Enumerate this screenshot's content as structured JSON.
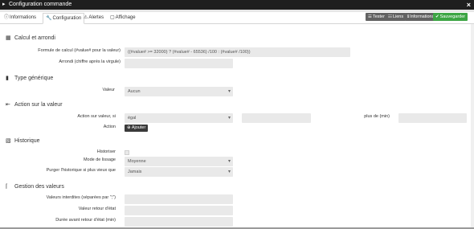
{
  "window": {
    "title": "Configuration commande",
    "close_label": "×"
  },
  "tabs": [
    {
      "label": "Informations",
      "icon": "info-icon"
    },
    {
      "label": "Configuration",
      "icon": "wrench-icon"
    },
    {
      "label": "Alertes",
      "icon": "warning-icon"
    },
    {
      "label": "Affichage",
      "icon": "display-icon"
    }
  ],
  "toolbar": {
    "tester": "Tester",
    "liens": "Liens",
    "informations": "Informations",
    "sauvegarder": "Sauvegarder"
  },
  "calcul": {
    "title": "Calcul et arrondi",
    "formula_label": "Formule de calcul (#value# pour la valeur)",
    "formula_value": "((#value# >= 32000) ? (#value# - 65536) /100 : (#value# /100))",
    "round_label": "Arrondi (chiffre après la virgule)",
    "round_value": ""
  },
  "type": {
    "title": "Type générique",
    "valeur_label": "Valeur",
    "valeur_value": "Aucun"
  },
  "action": {
    "title": "Action sur la valeur",
    "condition_label": "Action sur valeur, si",
    "condition_value": "égal",
    "compare_value": "",
    "duration_label": "plus de (min)",
    "duration_value": "",
    "action_label": "Action",
    "add_label": "Ajouter"
  },
  "historique": {
    "title": "Historique",
    "historiser_label": "Historiser",
    "lissage_label": "Mode de lissage",
    "lissage_value": "Moyenne",
    "purge_label": "Purger l'historique si plus vieux que",
    "purge_value": "Jamais"
  },
  "gestion": {
    "title": "Gestion des valeurs",
    "interdites_label": "Valeurs interdites (séparées par \";\")",
    "interdites_value": "",
    "retour_label": "Valeur retour d'état",
    "retour_value": "",
    "duree_label": "Durée avant retour d'état (min)",
    "duree_value": ""
  }
}
